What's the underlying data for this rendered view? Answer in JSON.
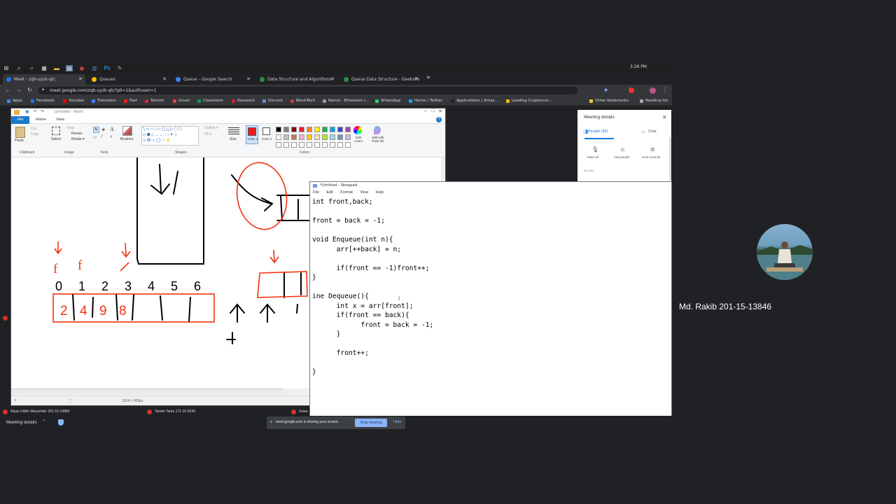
{
  "taskbar": {
    "time": "3:28 PM"
  },
  "tabs": [
    {
      "label": "Meet - zqb-uyzk-qtc",
      "color": "#1a73e8"
    },
    {
      "label": "Queues",
      "color": "#fbbc04"
    },
    {
      "label": "Queue - Google Search",
      "color": "#4285f4"
    },
    {
      "label": "Data Structure and Algorithms -",
      "color": "#2f8d46"
    },
    {
      "label": "Queue Data Structure - GeeksFo",
      "color": "#2f8d46"
    }
  ],
  "address": {
    "url": "meet.google.com/zqb-uyzk-qtc?pli=1&authuser=1"
  },
  "bookmarks": [
    {
      "label": "Apps",
      "color": "#4285f4"
    },
    {
      "label": "Facebook",
      "color": "#1877f2"
    },
    {
      "label": "Youtube",
      "color": "#ff0000"
    },
    {
      "label": "Translator",
      "color": "#4285f4"
    },
    {
      "label": "Fast",
      "color": "#e62117"
    },
    {
      "label": "Torrent",
      "color": "#d23"
    },
    {
      "label": "Gmail",
      "color": "#ea4335"
    },
    {
      "label": "Classroom",
      "color": "#0f9d58"
    },
    {
      "label": "Research",
      "color": "#c23"
    },
    {
      "label": "Discord",
      "color": "#7289da"
    },
    {
      "label": "BlockTech",
      "color": "#d33"
    },
    {
      "label": "Remix - Ethereum I...",
      "color": "#999"
    },
    {
      "label": "WhatsApp",
      "color": "#25d366"
    },
    {
      "label": "Home / Twitter",
      "color": "#1da1f2"
    },
    {
      "label": "Applications | Amaz...",
      "color": "#222"
    },
    {
      "label": "Leading Cryptocurr...",
      "color": "#f0b90b"
    },
    {
      "label": "Other bookmarks",
      "color": "#f4c430"
    },
    {
      "label": "Reading list",
      "color": "#aaa"
    }
  ],
  "paint": {
    "title": "Untitled - Paint",
    "menu": {
      "file": "File",
      "home": "Home",
      "view": "View"
    },
    "groups": {
      "clipboard": "Clipboard",
      "image": "Image",
      "tools": "Tools",
      "shapes": "Shapes",
      "colors": "Colors"
    },
    "buttons": {
      "paste": "Paste",
      "cut": "Cut",
      "copy": "Copy",
      "select": "Select",
      "crop": "Crop",
      "resize": "Resize",
      "rotate": "Rotate ▾",
      "brushes": "Brushes",
      "outline": "Outline ▾",
      "fill": "Fill ▾",
      "size": "Size",
      "color1": "Color 1",
      "color2": "Color 2",
      "edit_colors": "Edit colors",
      "paint3d": "Edit with Paint 3D"
    },
    "status": "1914 × 905px",
    "palette": [
      "#000000",
      "#7f7f7f",
      "#880015",
      "#ed1c24",
      "#ff7f27",
      "#fff200",
      "#22b14c",
      "#00a2e8",
      "#3f48cc",
      "#a349a4",
      "#ffffff",
      "#c3c3c3",
      "#b97a57",
      "#ffaec9",
      "#ffc90e",
      "#efe4b0",
      "#b5e61d",
      "#99d9ea",
      "#7092be",
      "#c8bfe7"
    ],
    "canvas": {
      "indices": [
        "0",
        "1",
        "2",
        "3",
        "4",
        "5",
        "6"
      ],
      "queue_values": [
        "2",
        "4",
        "9",
        "8"
      ],
      "pointer_labels": [
        "f",
        "f"
      ]
    }
  },
  "notepad": {
    "title": "*Untitled - Notepad",
    "menu": [
      "File",
      "Edit",
      "Format",
      "View",
      "Help"
    ],
    "code": "int front,back;\n\nfront = back = -1;\n\nvoid Enqueue(int n){\n\tarr[++back] = n;\n\n\tif(front == -1)front++;\n}\n\nine Dequeue(){\n\tint x = arr[front];\n\tif(front == back){\n\t\tfront = back = -1;\n\t}\n\n\tfront++;\n\n}"
  },
  "meeting_details": {
    "title": "Meeting details",
    "tabs": {
      "people": "People (36)",
      "chat": "Chat"
    },
    "actions": [
      "Mute all",
      "Add people",
      "Host controls"
    ],
    "section": "IN CALL"
  },
  "participants": [
    {
      "name": "Riyaz Uddin Mazumder 201-15-13884"
    },
    {
      "name": "Tamim Tanta 171-15-9249"
    },
    {
      "name": "Zawa"
    }
  ],
  "footer": {
    "meeting_details": "Meeting details"
  },
  "share_bar": {
    "message": "meet.google.com is sharing your screen.",
    "stop": "Stop sharing",
    "hide": "Hide"
  },
  "tile": {
    "name": "Md. Rakib 201-15-13846"
  }
}
